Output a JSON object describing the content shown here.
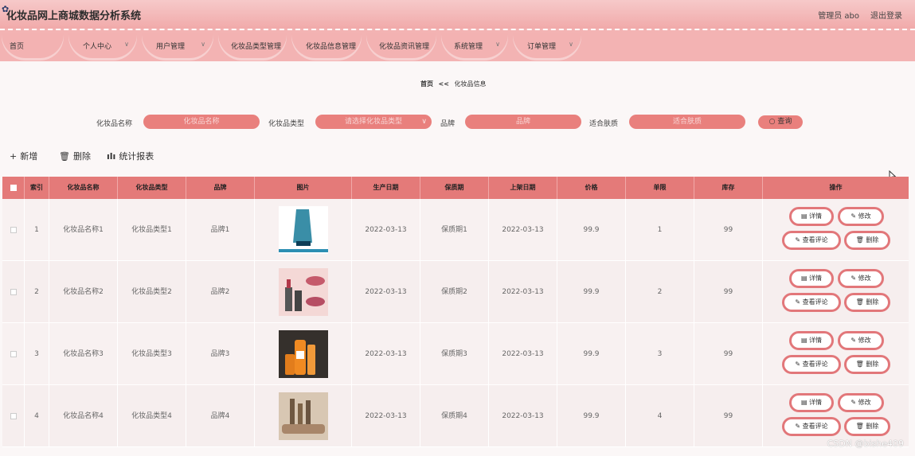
{
  "header": {
    "title": "化妆品网上商城数据分析系统",
    "user": "管理员 abo",
    "logout": "退出登录"
  },
  "nav": [
    {
      "label": "首页",
      "caret": false
    },
    {
      "label": "个人中心",
      "caret": true
    },
    {
      "label": "用户管理",
      "caret": true
    },
    {
      "label": "化妆品类型管理",
      "caret": true
    },
    {
      "label": "化妆品信息管理",
      "caret": true
    },
    {
      "label": "化妆品资讯管理",
      "caret": true
    },
    {
      "label": "系统管理",
      "caret": true
    },
    {
      "label": "订单管理",
      "caret": true
    }
  ],
  "breadcrumb": {
    "home": "首页",
    "sep": "<<",
    "current": "化妆品信息"
  },
  "search": {
    "name_label": "化妆品名称",
    "name_placeholder": "化妆品名称",
    "type_label": "化妆品类型",
    "type_placeholder": "请选择化妆品类型",
    "brand_label": "品牌",
    "brand_placeholder": "品牌",
    "skin_label": "适合肤质",
    "skin_placeholder": "适合肤质",
    "button": "查询"
  },
  "toolbar": {
    "add": "新增",
    "delete": "删除",
    "report": "统计报表"
  },
  "table": {
    "columns": [
      "",
      "索引",
      "化妆品名称",
      "化妆品类型",
      "品牌",
      "图片",
      "生产日期",
      "保质期",
      "上架日期",
      "价格",
      "单限",
      "库存",
      "操作"
    ],
    "actions": {
      "detail": "详情",
      "edit": "修改",
      "comments": "查看评论",
      "delete": "删除"
    },
    "rows": [
      {
        "index": "1",
        "name": "化妆品名称1",
        "type": "化妆品类型1",
        "brand": "品牌1",
        "image": "tube",
        "prod_date": "2022-03-13",
        "shelf_life": "保质期1",
        "list_date": "2022-03-13",
        "price": "99.9",
        "limit": "1",
        "stock": "99"
      },
      {
        "index": "2",
        "name": "化妆品名称2",
        "type": "化妆品类型2",
        "brand": "品牌2",
        "image": "lipstick",
        "prod_date": "2022-03-13",
        "shelf_life": "保质期2",
        "list_date": "2022-03-13",
        "price": "99.9",
        "limit": "2",
        "stock": "99"
      },
      {
        "index": "3",
        "name": "化妆品名称3",
        "type": "化妆品类型3",
        "brand": "品牌3",
        "image": "bottles",
        "prod_date": "2022-03-13",
        "shelf_life": "保质期3",
        "list_date": "2022-03-13",
        "price": "99.9",
        "limit": "3",
        "stock": "99"
      },
      {
        "index": "4",
        "name": "化妆品名称4",
        "type": "化妆品类型4",
        "brand": "品牌4",
        "image": "brushes",
        "prod_date": "2022-03-13",
        "shelf_life": "保质期4",
        "list_date": "2022-03-13",
        "price": "99.9",
        "limit": "4",
        "stock": "99"
      }
    ]
  },
  "watermark": "CSDN @bishe409",
  "colors": {
    "accent": "#e47a79",
    "nav": "#f3b3b3",
    "header": "#f1aaaa"
  }
}
